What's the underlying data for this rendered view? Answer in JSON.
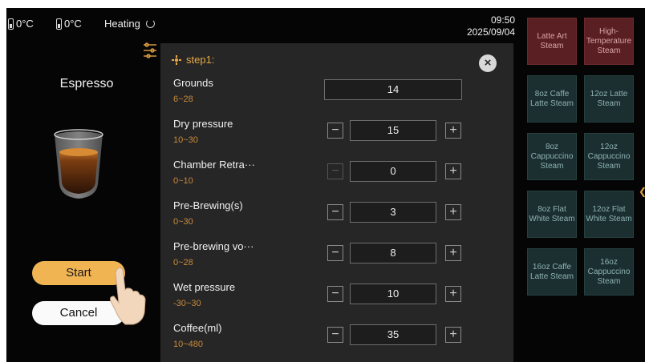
{
  "status": {
    "temp1": "0°C",
    "temp2": "0°C",
    "heating": "Heating",
    "time": "09:50",
    "date": "2025/09/04"
  },
  "left": {
    "drink_name": "Espresso",
    "start_label": "Start",
    "cancel_label": "Cancel"
  },
  "modal": {
    "step_title": "step1:",
    "close_symbol": "×",
    "params": [
      {
        "label": "Grounds",
        "range": "6~28",
        "value": "14"
      },
      {
        "label": "Dry pressure",
        "range": "10~30",
        "value": "15"
      },
      {
        "label": "Chamber Retra···",
        "range": "0~10",
        "value": "0"
      },
      {
        "label": "Pre-Brewing(s)",
        "range": "0~30",
        "value": "3"
      },
      {
        "label": "Pre-brewing vo···",
        "range": "0~28",
        "value": "8"
      },
      {
        "label": "Wet pressure",
        "range": "-30~30",
        "value": "10"
      },
      {
        "label": "Coffee(ml)",
        "range": "10~480",
        "value": "35"
      }
    ],
    "minus_symbol": "−",
    "plus_symbol": "+"
  },
  "drinks": [
    {
      "label": "Latte Art Steam",
      "active": true
    },
    {
      "label": "High-Temperature Steam",
      "active": true
    },
    {
      "label": "8oz Caffe Latte Steam",
      "active": false
    },
    {
      "label": "12oz Latte Steam",
      "active": false
    },
    {
      "label": "8oz Cappuccino Steam",
      "active": false
    },
    {
      "label": "12oz Cappuccino Steam",
      "active": false
    },
    {
      "label": "8oz Flat White Steam",
      "active": false
    },
    {
      "label": "12oz Flat White Steam",
      "active": false
    },
    {
      "label": "16oz Caffe Latte Steam",
      "active": false
    },
    {
      "label": "16oz Cappuccino Steam",
      "active": false
    }
  ],
  "colors": {
    "accent": "#f1b453",
    "active_tile": "#5a1f22",
    "tile": "#1b2f30",
    "modal": "#262626"
  },
  "icons": [
    "water-tank-icon",
    "heating-spinner-icon",
    "settings-sliders-icon",
    "step-gear-icon",
    "close-icon",
    "minus-icon",
    "plus-icon",
    "hand-pointer-icon",
    "chevron-left-icon"
  ]
}
